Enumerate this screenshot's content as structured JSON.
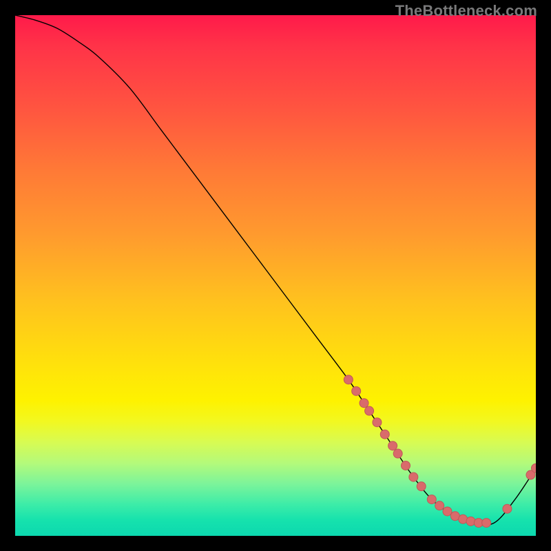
{
  "attribution": "TheBottleneck.com",
  "chart_data": {
    "type": "line",
    "title": "",
    "xlabel": "",
    "ylabel": "",
    "xlim": [
      0,
      100
    ],
    "ylim": [
      0,
      100
    ],
    "curve": {
      "x": [
        0,
        4,
        8,
        12,
        16,
        22,
        28,
        34,
        40,
        46,
        52,
        58,
        64,
        68,
        72,
        76,
        80,
        84,
        88,
        92,
        96,
        100
      ],
      "y": [
        100,
        99,
        97.5,
        95,
        92,
        86,
        78,
        70,
        62,
        54,
        46,
        38,
        30,
        24,
        18,
        12,
        7,
        4,
        2.5,
        2.5,
        7,
        13
      ]
    },
    "scatter": [
      {
        "x": 64.0,
        "y": 30.0
      },
      {
        "x": 65.5,
        "y": 27.8
      },
      {
        "x": 67.0,
        "y": 25.5
      },
      {
        "x": 68.0,
        "y": 24.0
      },
      {
        "x": 69.5,
        "y": 21.8
      },
      {
        "x": 71.0,
        "y": 19.5
      },
      {
        "x": 72.5,
        "y": 17.3
      },
      {
        "x": 73.5,
        "y": 15.8
      },
      {
        "x": 75.0,
        "y": 13.5
      },
      {
        "x": 76.5,
        "y": 11.3
      },
      {
        "x": 78.0,
        "y": 9.5
      },
      {
        "x": 80.0,
        "y": 7.0
      },
      {
        "x": 81.5,
        "y": 5.8
      },
      {
        "x": 83.0,
        "y": 4.7
      },
      {
        "x": 84.5,
        "y": 3.8
      },
      {
        "x": 86.0,
        "y": 3.2
      },
      {
        "x": 87.5,
        "y": 2.8
      },
      {
        "x": 89.0,
        "y": 2.5
      },
      {
        "x": 90.5,
        "y": 2.5
      },
      {
        "x": 94.5,
        "y": 5.2
      },
      {
        "x": 99.0,
        "y": 11.7
      },
      {
        "x": 100.0,
        "y": 13.0
      }
    ]
  }
}
